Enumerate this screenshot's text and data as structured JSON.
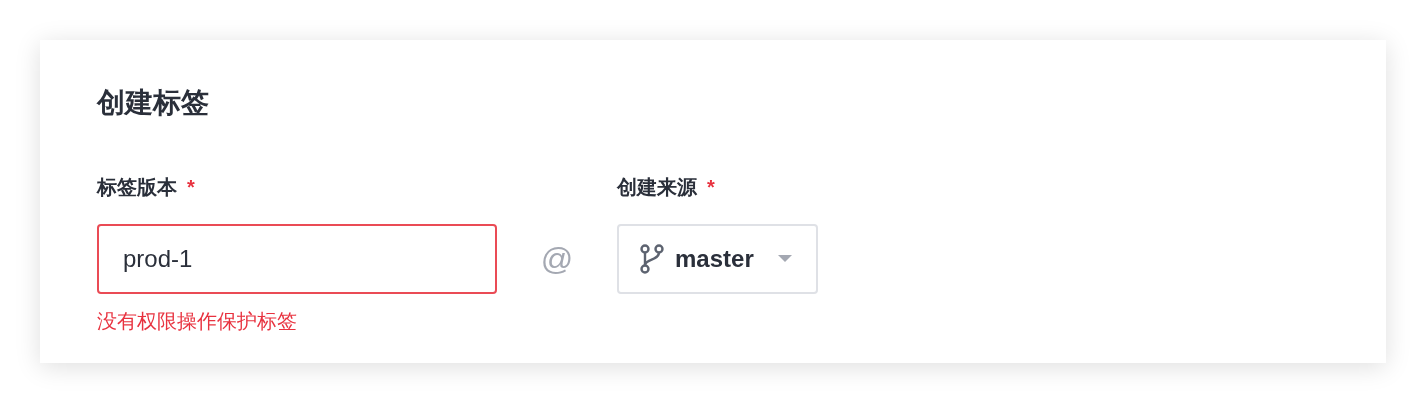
{
  "title": "创建标签",
  "fields": [
    {
      "kind": "input",
      "label": "标签版本",
      "required_mark": "*",
      "value": "prod-1",
      "invalid": true,
      "error": "没有权限操作保护标签"
    },
    {
      "kind": "separator",
      "text": "@"
    },
    {
      "kind": "select",
      "label": "创建来源",
      "required_mark": "*",
      "value": "master",
      "invalid": false
    }
  ]
}
